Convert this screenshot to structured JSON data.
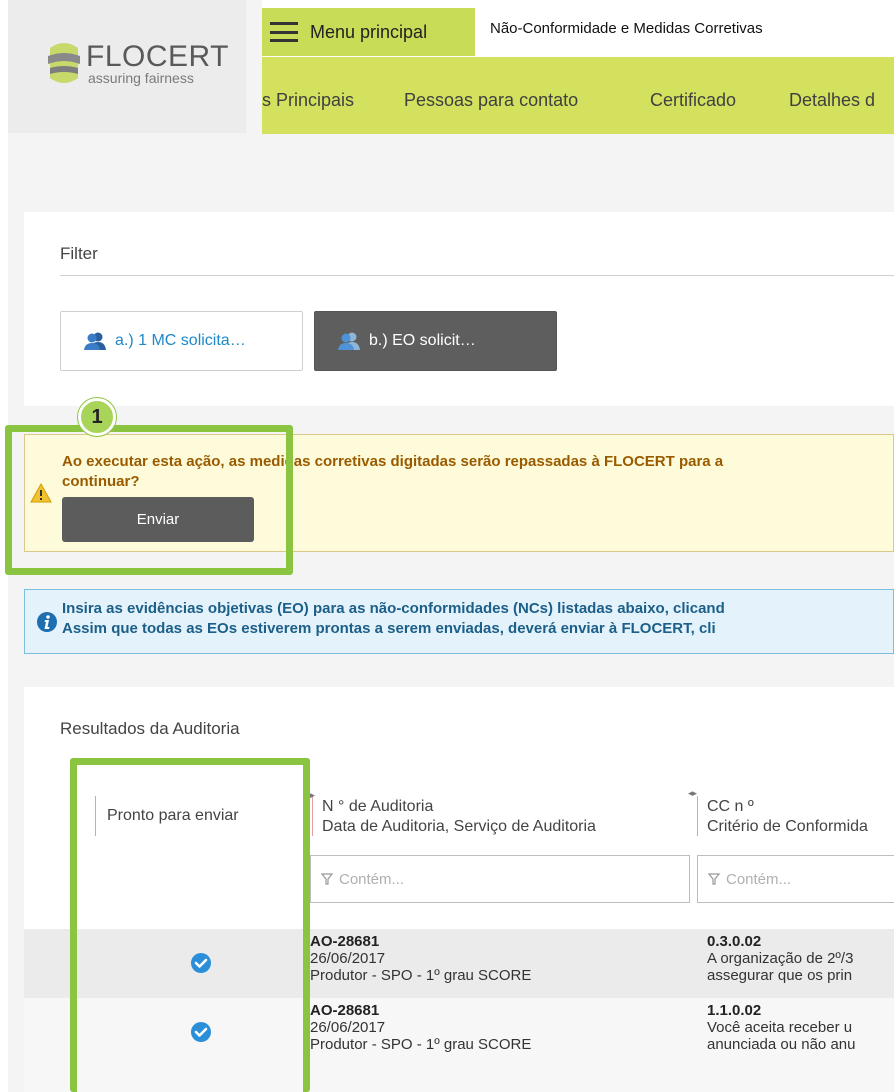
{
  "logo": {
    "name": "FLOCERT",
    "tagline": "assuring fairness"
  },
  "topbar": {
    "menu_label": "Menu principal",
    "page_title": "Não-Conformidade e Medidas Corretivas"
  },
  "nav": {
    "items": [
      "s Principais",
      "Pessoas para contato",
      "Certificado",
      "Detalhes d"
    ]
  },
  "filter": {
    "title": "Filter",
    "chips": [
      {
        "label": "a.) 1 MC solicita…",
        "active": false
      },
      {
        "label": "b.) EO solicit…",
        "active": true
      }
    ]
  },
  "warning": {
    "line1": "Ao executar esta ação, as medidas corretivas digitadas serão repassadas à FLOCERT para a",
    "line2": "continuar?",
    "button_label": "Enviar"
  },
  "callout": {
    "number": "1"
  },
  "info": {
    "line1": "Insira as evidências objetivas (EO) para as não-conformidades (NCs) listadas abaixo, clicand",
    "line2": "Assim que todas as EOs estiverem prontas a serem enviadas, deverá enviar à FLOCERT, cli"
  },
  "results": {
    "title": "Resultados da Auditoria",
    "columns": [
      {
        "line1": "Pronto para enviar",
        "line2": ""
      },
      {
        "line1": "N ° de Auditoria",
        "line2": "Data de Auditoria, Serviço de Auditoria"
      },
      {
        "line1": "CC n º",
        "line2": "Critério de Conformida"
      }
    ],
    "filter_placeholder": "Contém...",
    "rows": [
      {
        "ready": true,
        "audit_no": "AO-28681",
        "audit_date": "26/06/2017",
        "audit_service": "Produtor - SPO - 1º grau SCORE",
        "cc_no": "0.3.0.02",
        "criterion_l1": "A organização de 2º/3",
        "criterion_l2": "assegurar que os prin"
      },
      {
        "ready": true,
        "audit_no": "AO-28681",
        "audit_date": "26/06/2017",
        "audit_service": "Produtor - SPO - 1º grau SCORE",
        "cc_no": "1.1.0.02",
        "criterion_l1": "Você aceita receber u",
        "criterion_l2": "anunciada ou não anu"
      }
    ]
  },
  "colors": {
    "accent_green": "#d3e15f",
    "highlight": "#8bc440",
    "check_blue": "#2a8fd8"
  },
  "icons": [
    "hamburger-icon",
    "user-group-icon",
    "warning-icon",
    "info-icon",
    "filter-icon",
    "check-circle-icon"
  ]
}
